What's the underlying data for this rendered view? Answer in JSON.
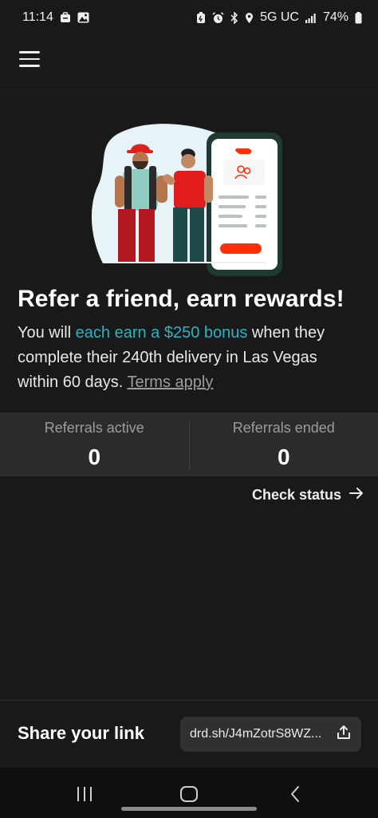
{
  "status_bar": {
    "time": "11:14",
    "network": "5G UC",
    "battery": "74%"
  },
  "header": {
    "menu_icon": "hamburger-menu-icon"
  },
  "hero": {
    "illustration": "two-people-with-phone-illustration"
  },
  "headline": "Refer a friend, earn rewards!",
  "description": {
    "part1": "You will ",
    "highlight": "each earn a $250 bonus",
    "part2": " when they complete their 240th delivery in Las Vegas within 60 days. ",
    "terms_link": "Terms apply"
  },
  "stats": {
    "active_label": "Referrals active",
    "active_value": "0",
    "ended_label": "Referrals ended",
    "ended_value": "0"
  },
  "check_status": {
    "label": "Check status",
    "icon": "arrow-right-icon"
  },
  "share": {
    "label": "Share your link",
    "link": "drd.sh/J4mZotrS8WZ...",
    "icon": "share-icon"
  },
  "nav": {
    "recents_icon": "recents-icon",
    "home_icon": "home-icon",
    "back_icon": "back-icon"
  },
  "colors": {
    "background": "#191919",
    "highlight": "#2bb3c4",
    "brand_red": "#ff3008",
    "stats_bg": "#2b2b2b"
  }
}
